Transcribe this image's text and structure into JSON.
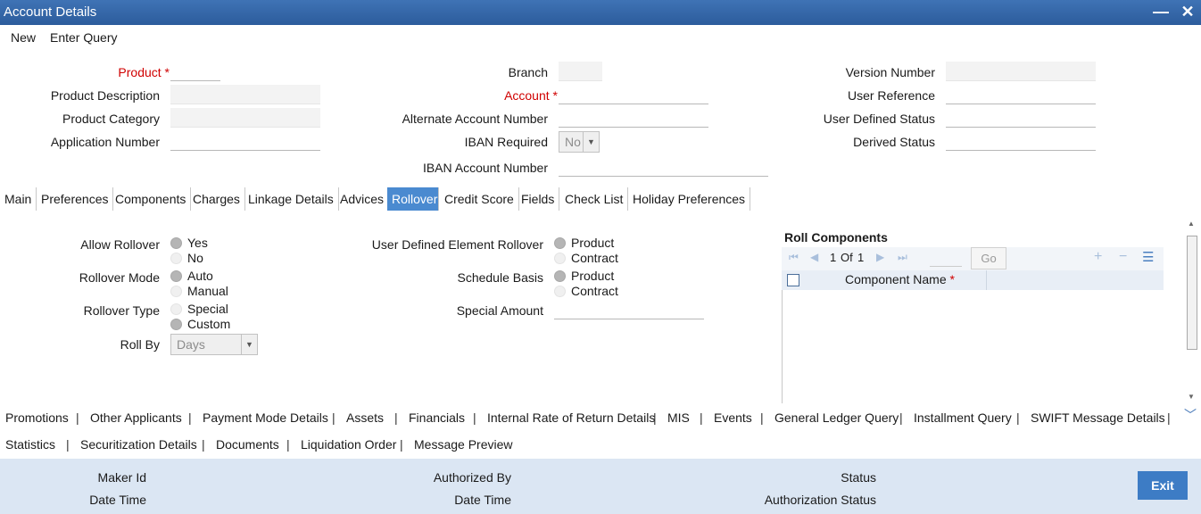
{
  "window": {
    "title": "Account Details",
    "minimize": "—",
    "close": "✕"
  },
  "menu": [
    "New",
    "Enter Query"
  ],
  "header": {
    "col1": [
      {
        "label": "Product",
        "required": true,
        "value": ""
      },
      {
        "label": "Product Description",
        "required": false,
        "value": ""
      },
      {
        "label": "Product Category",
        "required": false,
        "value": ""
      },
      {
        "label": "Application Number",
        "required": false,
        "value": ""
      }
    ],
    "col2": [
      {
        "label": "Branch",
        "required": false,
        "value": ""
      },
      {
        "label": "Account",
        "required": true,
        "value": ""
      },
      {
        "label": "Alternate Account Number",
        "required": false,
        "value": ""
      },
      {
        "label": "IBAN Required",
        "required": false,
        "value": "No"
      },
      {
        "label": "IBAN Account Number",
        "required": false,
        "value": ""
      }
    ],
    "col3": [
      {
        "label": "Version Number",
        "value": ""
      },
      {
        "label": "User Reference",
        "value": ""
      },
      {
        "label": "User Defined Status",
        "value": ""
      },
      {
        "label": "Derived Status",
        "value": ""
      }
    ]
  },
  "tabs": [
    "Main",
    "Preferences",
    "Components",
    "Charges",
    "Linkage Details",
    "Advices",
    "Rollover",
    "Credit Score",
    "Fields",
    "Check List",
    "Holiday Preferences"
  ],
  "active_tab": "Rollover",
  "rollover": {
    "allow_rollover": {
      "label": "Allow Rollover",
      "options": [
        "Yes",
        "No"
      ],
      "selected": "Yes"
    },
    "rollover_mode": {
      "label": "Rollover Mode",
      "options": [
        "Auto",
        "Manual"
      ],
      "selected": "Auto"
    },
    "rollover_type": {
      "label": "Rollover Type",
      "options": [
        "Special",
        "Custom"
      ],
      "selected": "Custom"
    },
    "roll_by": {
      "label": "Roll By",
      "value": "Days"
    },
    "ude_rollover": {
      "label": "User Defined Element Rollover",
      "options": [
        "Product",
        "Contract"
      ],
      "selected": "Product"
    },
    "schedule_basis": {
      "label": "Schedule Basis",
      "options": [
        "Product",
        "Contract"
      ],
      "selected": "Product"
    },
    "special_amount": {
      "label": "Special Amount",
      "value": ""
    }
  },
  "roll_components": {
    "title": "Roll Components",
    "page": "1",
    "of_label": "Of",
    "total": "1",
    "go": "Go",
    "column": "Component Name",
    "required_mark": "*"
  },
  "links_row1": [
    "Promotions",
    "Other Applicants",
    "Payment Mode Details",
    "Assets",
    "Financials",
    "Internal Rate of Return Details",
    "MIS",
    "Events",
    "General Ledger Query",
    "Installment Query",
    "SWIFT Message Details"
  ],
  "links_row2": [
    "Statistics",
    "Securitization Details",
    "Documents",
    "Liquidation Order",
    "Message Preview"
  ],
  "footer": {
    "maker_id": "Maker Id",
    "date_time_1": "Date Time",
    "authorized_by": "Authorized By",
    "date_time_2": "Date Time",
    "status": "Status",
    "authorization_status": "Authorization Status",
    "exit": "Exit"
  },
  "colors": {
    "title_bar": "#2c5c9c",
    "active_tab": "#4a8ad0",
    "footer": "#dbe6f3",
    "required": "#d00000"
  }
}
